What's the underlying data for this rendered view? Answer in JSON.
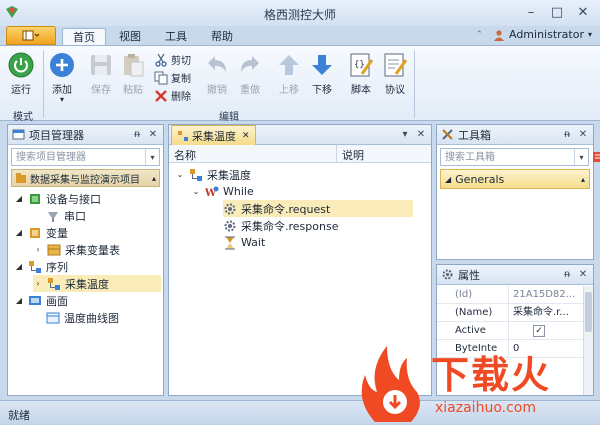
{
  "window": {
    "title": "格西测控大师"
  },
  "ribbon_tabs": [
    {
      "label": "首页",
      "active": true
    },
    {
      "label": "视图",
      "active": false
    },
    {
      "label": "工具",
      "active": false
    },
    {
      "label": "帮助",
      "active": false
    }
  ],
  "user": {
    "name": "Administrator"
  },
  "ribbon": {
    "run": "运行",
    "mode_group": "模式",
    "add": "添加",
    "save": "保存",
    "paste": "粘贴",
    "cut": "剪切",
    "copy": "复制",
    "delete": "删除",
    "undo": "撤销",
    "redo": "重做",
    "move_up": "上移",
    "move_down": "下移",
    "script": "脚本",
    "protocol": "协议",
    "edit_group": "编辑"
  },
  "project_manager": {
    "title": "项目管理器",
    "search_placeholder": "搜索项目管理器",
    "project_name": "数据采集与监控演示项目",
    "tree": [
      {
        "label": "设备与接口"
      },
      {
        "label": "串口"
      },
      {
        "label": "变量"
      },
      {
        "label": "采集变量表"
      },
      {
        "label": "序列"
      },
      {
        "label": "采集温度"
      },
      {
        "label": "画面"
      },
      {
        "label": "温度曲线图"
      }
    ]
  },
  "document": {
    "tab_label": "采集温度",
    "col_name": "名称",
    "col_desc": "说明",
    "tree": [
      {
        "label": "采集温度"
      },
      {
        "label": "While"
      },
      {
        "label": "采集命令.request"
      },
      {
        "label": "采集命令.response"
      },
      {
        "label": "Wait"
      }
    ]
  },
  "toolbox": {
    "title": "工具箱",
    "search_placeholder": "搜索工具箱",
    "group": "Generals"
  },
  "properties": {
    "title": "属性",
    "rows": [
      {
        "key": "(Id)",
        "value": "21A15D82..."
      },
      {
        "key": "(Name)",
        "value": "采集命令.r..."
      },
      {
        "key": "Active",
        "value": "✓"
      },
      {
        "key": "ByteInte",
        "value": "0"
      }
    ]
  },
  "status": {
    "text": "就绪"
  },
  "watermark": {
    "brand": "下载火",
    "url": "xiazaihuo.com"
  },
  "colors": {
    "file_tab": "#f0a321",
    "selected_row": "#f9ecb8",
    "watermark": "#f04a24"
  }
}
